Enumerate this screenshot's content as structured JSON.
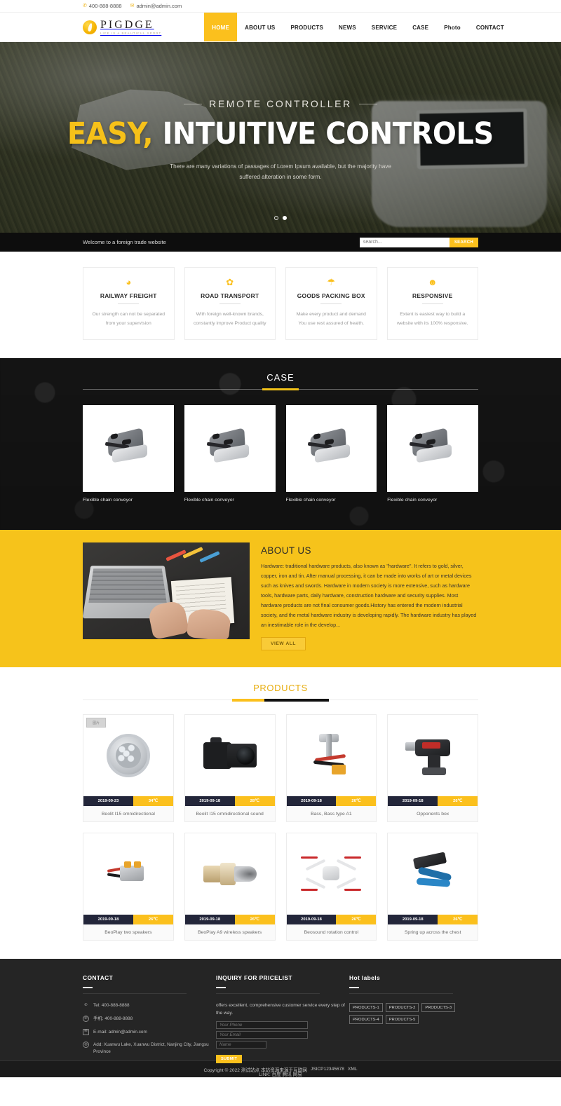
{
  "topbar": {
    "phone": "400-888-8888",
    "email": "admin@admin.com",
    "phone_icon": "phone-icon",
    "mail_icon": "mail-icon"
  },
  "brand": {
    "name": "PIGDGE",
    "tagline": "LIFE IS A BEAUTIFUL SPORT"
  },
  "nav": {
    "items": [
      {
        "label": "HOME",
        "active": true
      },
      {
        "label": "ABOUT US",
        "active": false
      },
      {
        "label": "PRODUCTS",
        "active": false
      },
      {
        "label": "NEWS",
        "active": false
      },
      {
        "label": "SERVICE",
        "active": false
      },
      {
        "label": "CASE",
        "active": false
      },
      {
        "label": "Photo",
        "active": false
      },
      {
        "label": "CONTACT",
        "active": false
      }
    ]
  },
  "hero": {
    "kicker": "REMOTE CONTROLLER",
    "title_highlight": "EASY,",
    "title_rest": " INTUITIVE CONTROLS",
    "subtitle": "There are many variations of passages of Lorem Ipsum available, but the majority have suffered alteration in some form.",
    "slides": 2,
    "active_slide": 2
  },
  "welcome": {
    "text": "Welcome to a foreign trade website",
    "search_placeholder": "search...",
    "search_value": "",
    "search_button": "SEARCH"
  },
  "features": [
    {
      "icon": "pie-chart-icon",
      "glyph": "◕",
      "title": "RAILWAY FREIGHT",
      "desc": "Our strength can not be separated from your supervision"
    },
    {
      "icon": "gear-icon",
      "glyph": "✿",
      "title": "ROAD TRANSPORT",
      "desc": "With foreign well-known brands, constantly improve Product quality"
    },
    {
      "icon": "umbrella-icon",
      "glyph": "☂",
      "title": "GOODS PACKING BOX",
      "desc": "Make every product and demand You use rest assured of health."
    },
    {
      "icon": "user-icon",
      "glyph": "☻",
      "title": "RESPONSIVE",
      "desc": "Extent is easiest way to build a website with its 100% responsive."
    }
  ],
  "case": {
    "title": "CASE",
    "items": [
      {
        "caption": "Flexible chain conveyor"
      },
      {
        "caption": "Flexible chain conveyor"
      },
      {
        "caption": "Flexible chain conveyor"
      },
      {
        "caption": "Flexible chain conveyor"
      }
    ]
  },
  "about": {
    "title": "ABOUT US",
    "body": "Hardware: traditional hardware products, also known as \"hardware\". It refers to gold, silver, copper, iron and tin. After manual processing, it can be made into works of art or metal devices such as knives and swords. Hardware in modern society is more extensive, such as hardware tools, hardware parts, daily hardware, construction hardware and security supplies. Most hardware products are not final consumer goods.History has entered the modern industrial society, and the metal hardware industry is developing rapidly. The hardware industry has played an inestimable role in the develop...",
    "button": "VIEW ALL"
  },
  "products": {
    "title": "PRODUCTS",
    "badge_label": "图片",
    "items": [
      {
        "date": "2019-09-23",
        "temp": "34℃",
        "name": "Beolit I15 omnidirectional",
        "illustration": "led-lamp",
        "has_badge": true
      },
      {
        "date": "2019-09-18",
        "temp": "28℃",
        "name": "Beolit I15 omnidirectional sound",
        "illustration": "camera",
        "has_badge": false
      },
      {
        "date": "2019-09-18",
        "temp": "26℃",
        "name": "Bass, Bass type A1",
        "illustration": "hand-tool",
        "has_badge": false
      },
      {
        "date": "2019-09-18",
        "temp": "26℃",
        "name": "Opponents box",
        "illustration": "cordless-drill",
        "has_badge": false
      },
      {
        "date": "2019-09-18",
        "temp": "26℃",
        "name": "BeoPlay two speakers",
        "illustration": "wire-connector",
        "has_badge": false
      },
      {
        "date": "2019-09-18",
        "temp": "26℃",
        "name": "BeoPlay A9 wireless speakers",
        "illustration": "brass-pipe",
        "has_badge": false
      },
      {
        "date": "2019-09-18",
        "temp": "26℃",
        "name": "Beosound rotation control",
        "illustration": "quadcopter",
        "has_badge": false
      },
      {
        "date": "2019-09-18",
        "temp": "26℃",
        "name": "Spring up across the chest",
        "illustration": "crimping-tool",
        "has_badge": false
      }
    ]
  },
  "footer": {
    "contact": {
      "heading": "CONTACT",
      "items": [
        {
          "icon": "phone-icon",
          "glyph": "✆",
          "text": "Tel:  400-888-8888"
        },
        {
          "icon": "whatsapp-icon",
          "glyph": "✆",
          "text": "手机:  400-888-8888"
        },
        {
          "icon": "mail-icon",
          "glyph": "✉",
          "text": "E-mail: admin@admin.com"
        },
        {
          "icon": "location-pin-icon",
          "glyph": "◎",
          "text": "Add:  Xuanwu Lake, Xuanwu District, Nanjing City, Jiangsu Province"
        }
      ]
    },
    "inquiry": {
      "heading": "INQUIRY FOR PRICELIST",
      "text": "offers excellent, comprehensive customer service every step of the way.",
      "phone_placeholder": "Your Phone",
      "email_placeholder": "Your Email",
      "name_placeholder": "Name",
      "submit_label": "SUBMIT"
    },
    "hot": {
      "heading": "Hot labels",
      "tags": [
        "PRODUCTS-1",
        "PRODUCTS-2",
        "PRODUCTS-3",
        "PRODUCTS-4",
        "PRODUCTS-5"
      ]
    },
    "link_label": "LINK:",
    "links": [
      "百度",
      "腾讯",
      "网易"
    ],
    "copyright": "Copyright © 2022 测试站点 本站资源来源于互联网",
    "icp": "JSICP12345678",
    "xml": "XML"
  },
  "colors": {
    "accent": "#fbc01d",
    "accent_dark": "#e8ae10",
    "about_bg": "#f6c31b",
    "dark": "#252525",
    "meta_navy": "#23263a"
  }
}
